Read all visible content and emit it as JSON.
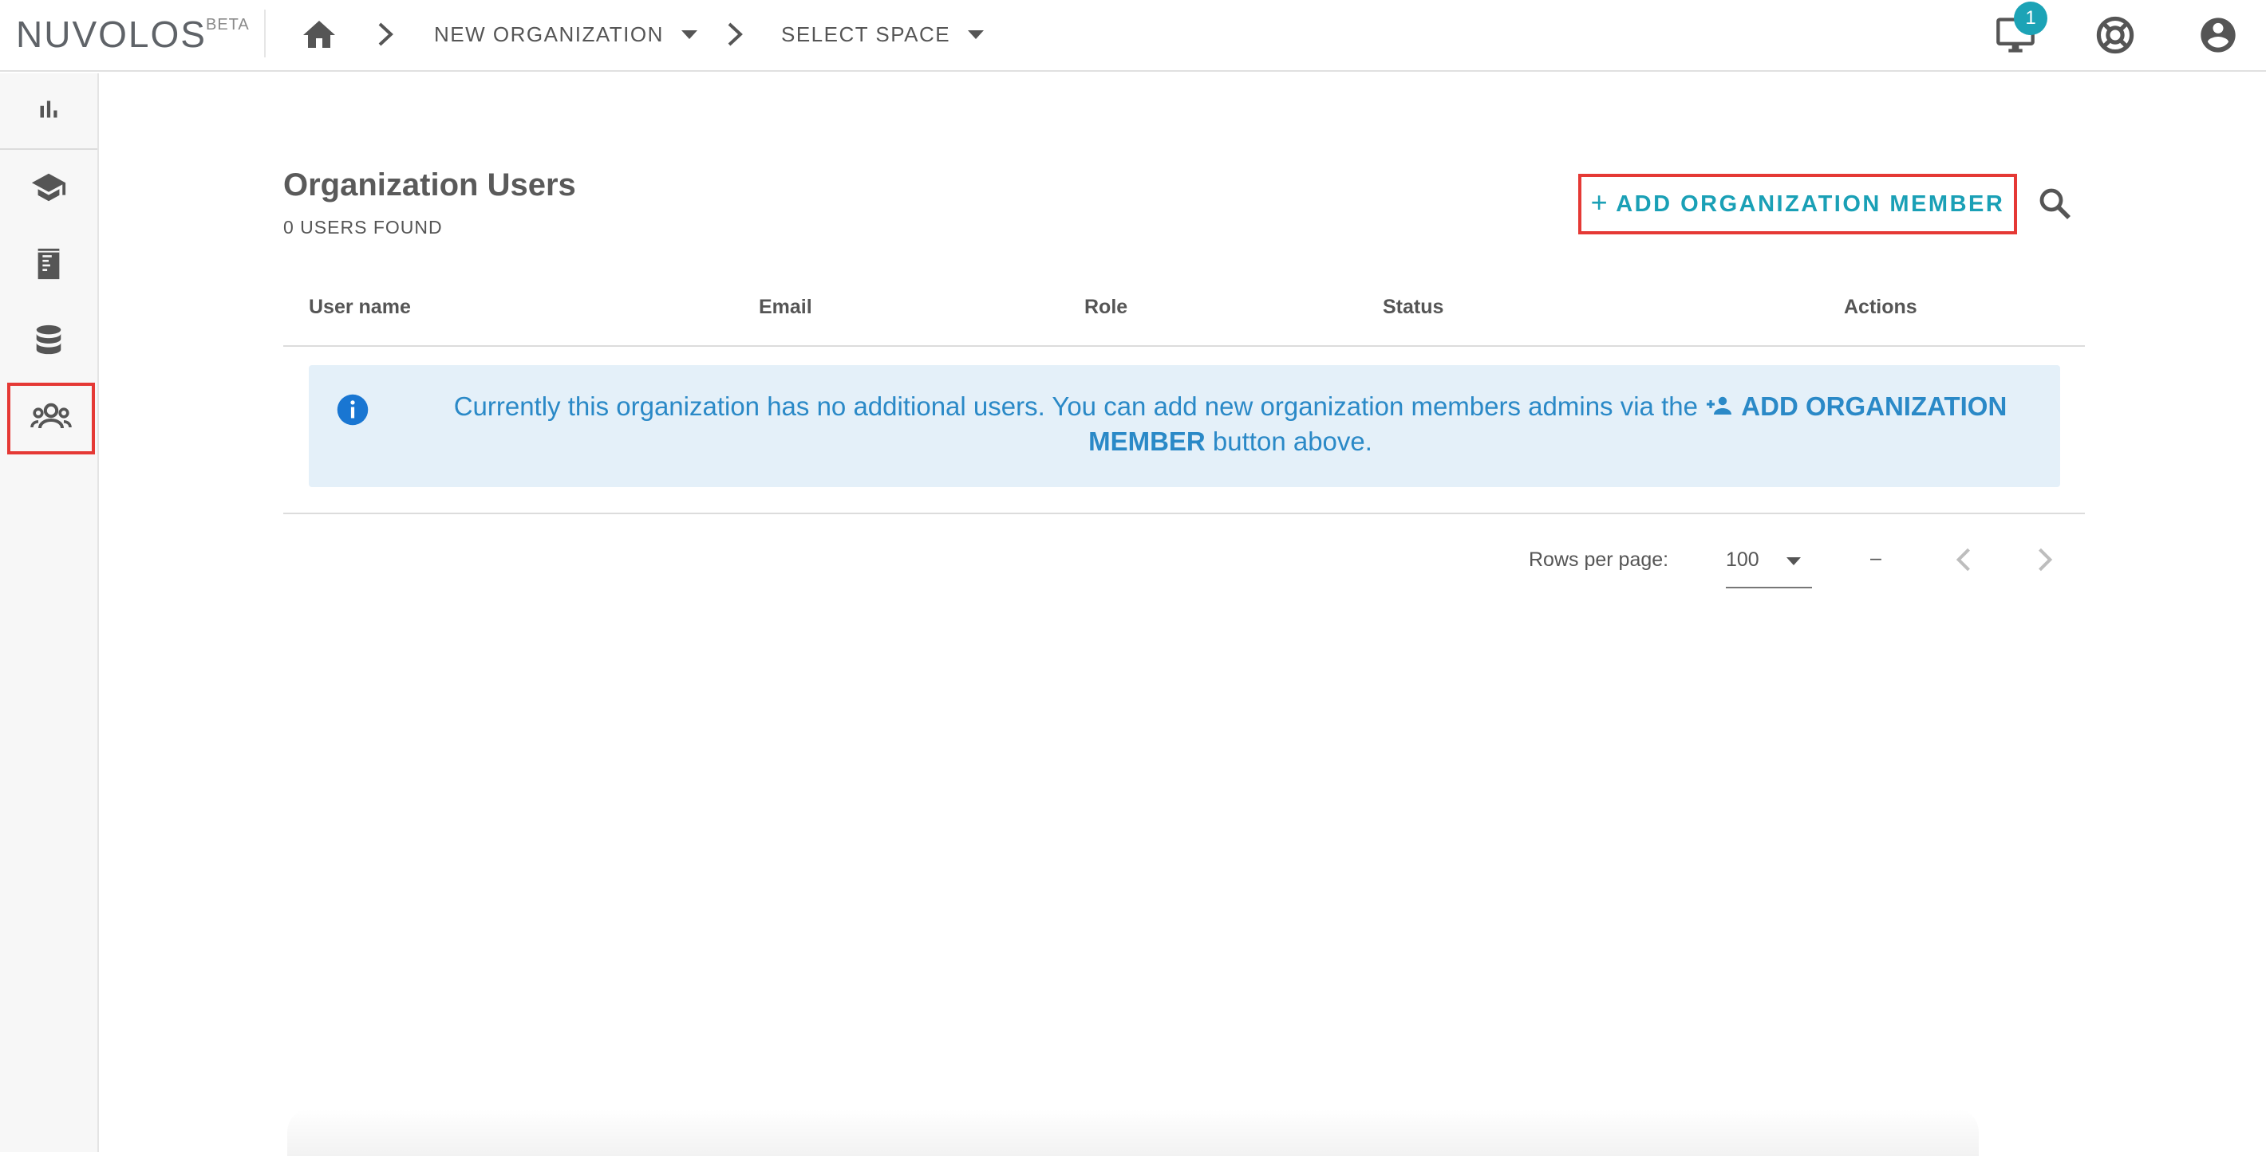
{
  "header": {
    "logo": "NUVOLOS",
    "logo_badge": "BETA",
    "breadcrumb": {
      "organization": "NEW ORGANIZATION",
      "space": "SELECT SPACE"
    },
    "notifications_count": "1",
    "icons": [
      "home-icon",
      "monitor-icon",
      "lifebuoy-icon",
      "account-icon"
    ]
  },
  "sidebar": {
    "items": [
      {
        "icon": "bar-chart-icon",
        "active": false
      },
      {
        "icon": "graduation-cap-icon",
        "active": false
      },
      {
        "icon": "notebook-icon",
        "active": false
      },
      {
        "icon": "database-icon",
        "active": false
      },
      {
        "icon": "users-icon",
        "active": true
      }
    ]
  },
  "main": {
    "title": "Organization Users",
    "subtitle": "0 USERS FOUND",
    "add_button_label": "ADD ORGANIZATION MEMBER",
    "columns": [
      "User name",
      "Email",
      "Role",
      "Status",
      "Actions"
    ],
    "empty_message_prefix": "Currently this organization has no additional users. You can add new organization members admins via the",
    "empty_message_link": "ADD ORGANIZATION MEMBER",
    "empty_message_suffix": "button above.",
    "pagination": {
      "rows_per_page_label": "Rows per page:",
      "rows_per_page_value": "100",
      "range": "–"
    }
  },
  "colors": {
    "accent": "#1aa0b6",
    "highlight_border": "#e53935",
    "info_background": "#e4f0f9",
    "info_text": "#2a89c7"
  }
}
